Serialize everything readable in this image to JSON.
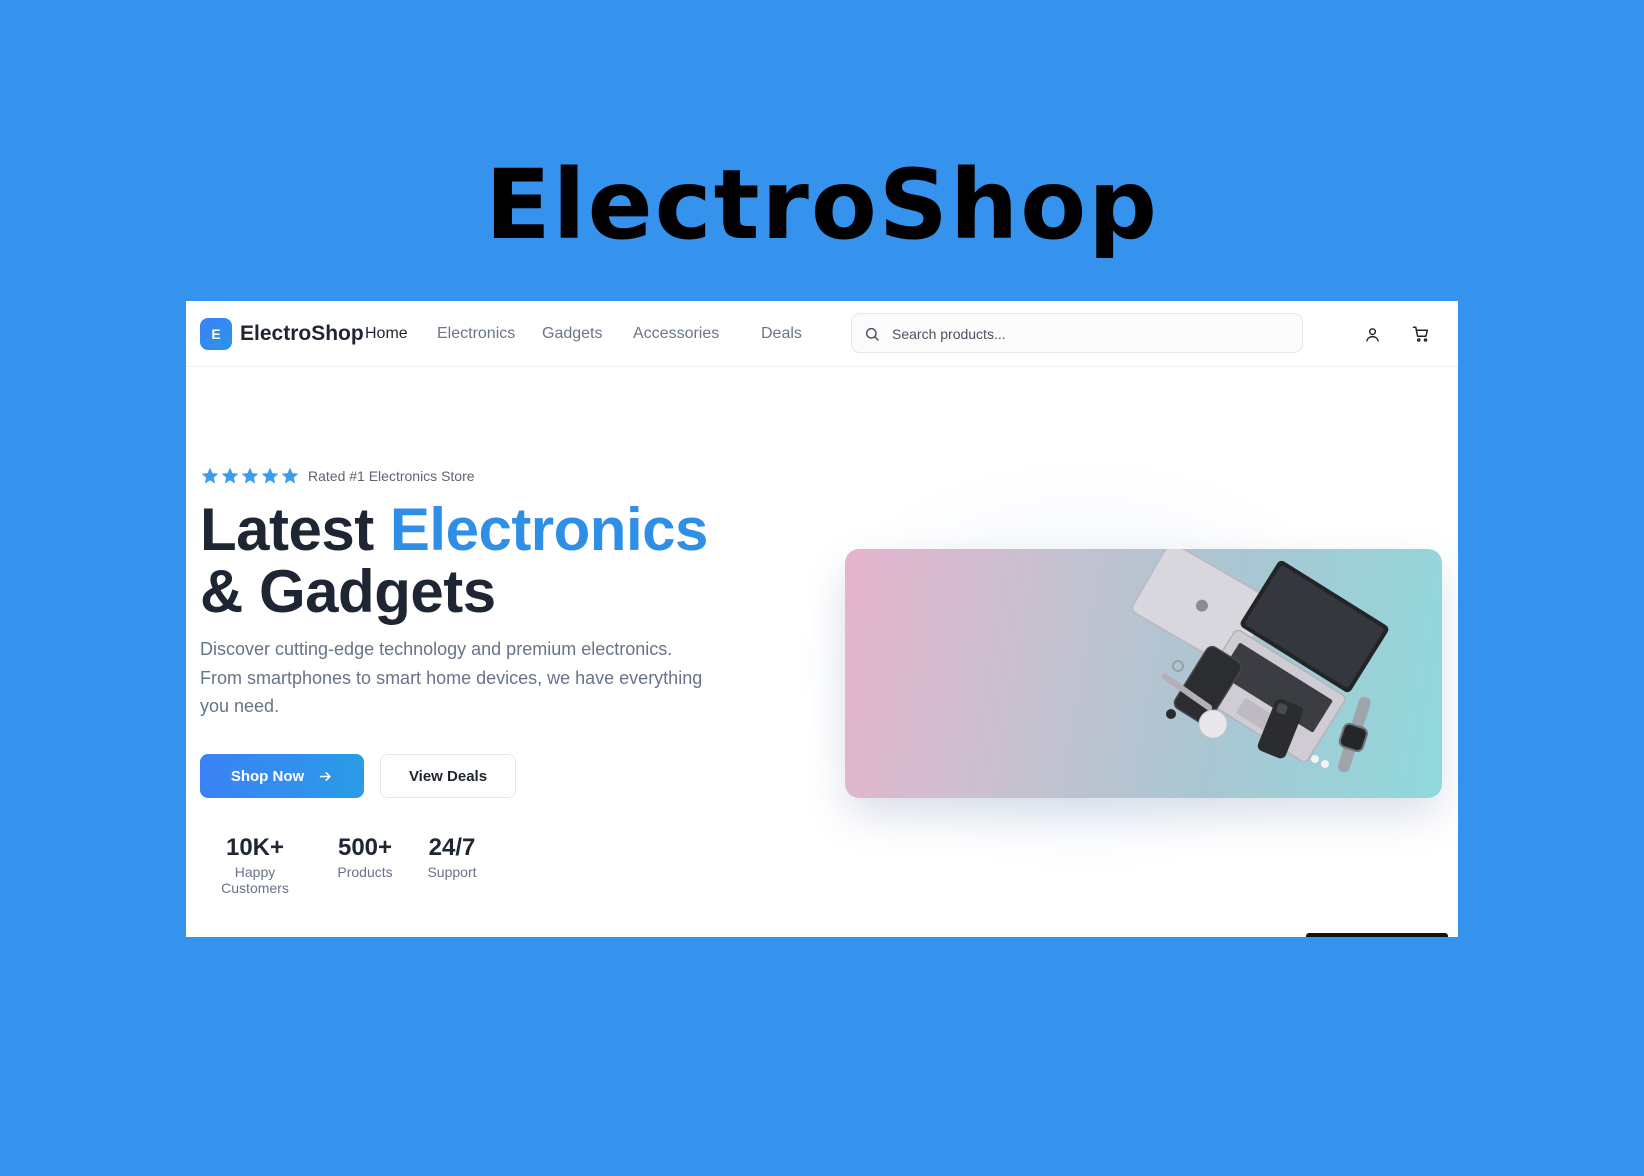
{
  "banner": {
    "title": "ElectroShop"
  },
  "nav": {
    "logo_letter": "E",
    "brand": "ElectroShop",
    "links": [
      "Home",
      "Electronics",
      "Gadgets",
      "Accessories",
      "Deals"
    ],
    "active_link": "Home",
    "search_placeholder": "Search products...",
    "icons": [
      "search-icon",
      "user-icon",
      "cart-icon"
    ]
  },
  "hero": {
    "rating_stars": 5,
    "rating_text": "Rated #1 Electronics Store",
    "headline_part1": "Latest ",
    "headline_accent": "Electronics",
    "headline_part2": "& Gadgets",
    "description": "Discover cutting-edge technology and premium electronics. From smartphones to smart home devices, we have everything you need.",
    "primary_button": "Shop Now",
    "secondary_button": "View Deals",
    "stats": [
      {
        "value": "10K+",
        "label": "Happy Customers"
      },
      {
        "value": "500+",
        "label": "Products"
      },
      {
        "value": "24/7",
        "label": "Support"
      }
    ]
  },
  "colors": {
    "background": "#3593ee",
    "accent": "#2f8fe6",
    "star": "#3b9cf0",
    "text_dark": "#1f2633",
    "text_muted": "#667488"
  }
}
